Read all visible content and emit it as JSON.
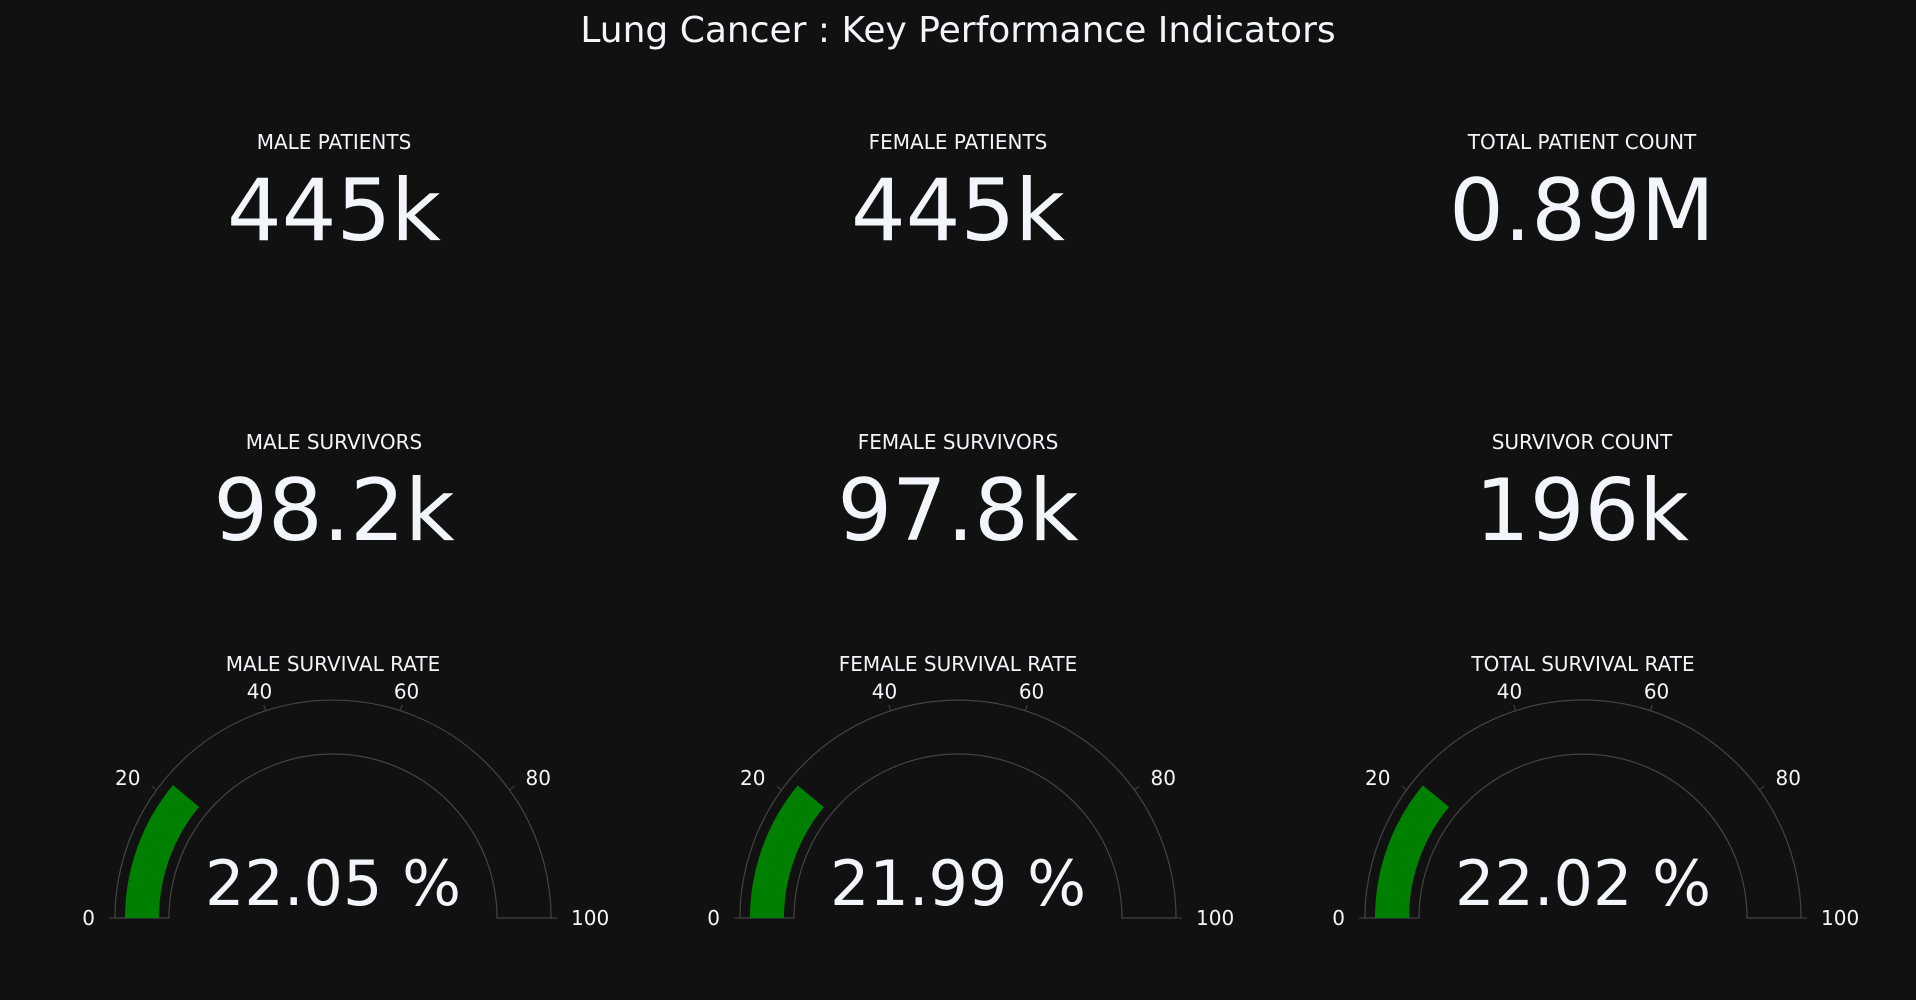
{
  "title": "Lung Cancer : Key Performance Indicators",
  "colors": {
    "background": "#111111",
    "text": "#f2f5fa",
    "gauge_bar": "#008000",
    "gauge_outline": "#444444"
  },
  "chart_data": [
    {
      "type": "indicator",
      "title": "MALE PATIENTS",
      "value": 445000,
      "display": "445k"
    },
    {
      "type": "indicator",
      "title": "FEMALE PATIENTS",
      "value": 445000,
      "display": "445k"
    },
    {
      "type": "indicator",
      "title": "TOTAL PATIENT COUNT",
      "value": 890000,
      "display": "0.89M"
    },
    {
      "type": "indicator",
      "title": "MALE SURVIVORS",
      "value": 98200,
      "display": "98.2k"
    },
    {
      "type": "indicator",
      "title": "FEMALE SURVIVORS",
      "value": 97800,
      "display": "97.8k"
    },
    {
      "type": "indicator",
      "title": "SURVIVOR COUNT",
      "value": 196000,
      "display": "196k"
    },
    {
      "type": "gauge",
      "title": "MALE SURVIVAL RATE",
      "value": 22.05,
      "display": "22.05 %",
      "range": [
        0,
        100
      ],
      "ticks": [
        0,
        20,
        40,
        60,
        80,
        100
      ]
    },
    {
      "type": "gauge",
      "title": "FEMALE SURVIVAL RATE",
      "value": 21.99,
      "display": "21.99 %",
      "range": [
        0,
        100
      ],
      "ticks": [
        0,
        20,
        40,
        60,
        80,
        100
      ]
    },
    {
      "type": "gauge",
      "title": "TOTAL SURVIVAL RATE",
      "value": 22.02,
      "display": "22.02 %",
      "range": [
        0,
        100
      ],
      "ticks": [
        0,
        20,
        40,
        60,
        80,
        100
      ]
    }
  ]
}
